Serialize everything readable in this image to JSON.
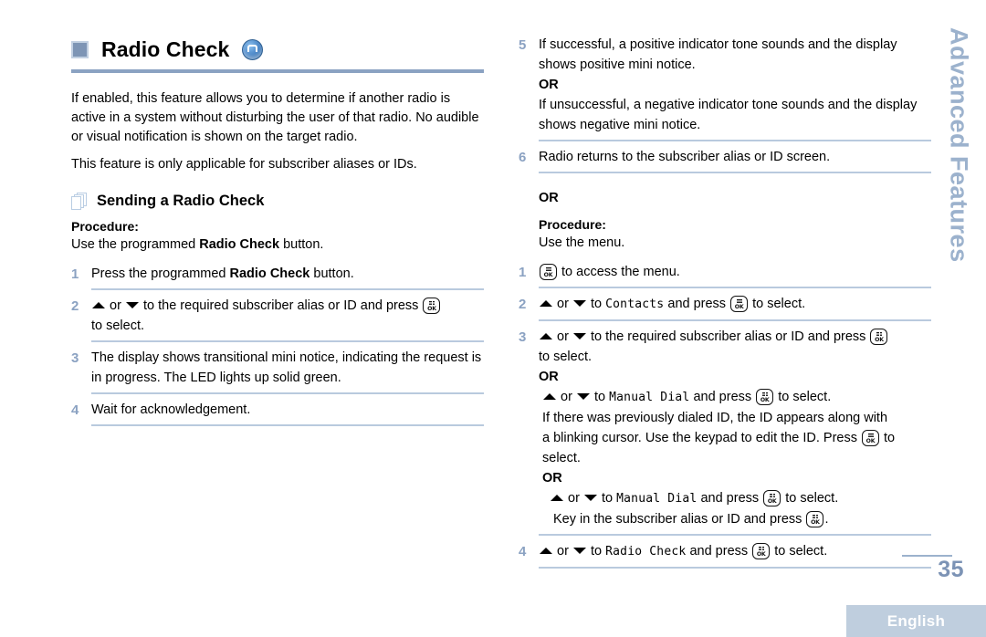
{
  "chapter": {
    "title": "Radio Check",
    "badge_icon": "radio-signal-icon",
    "bullet_icon": "square-bullet-icon"
  },
  "intro": {
    "paragraph_1": "If enabled, this feature allows you to determine if another radio is active in a system without disturbing the user of that radio. No audible or visual notification is shown on the target radio.",
    "paragraph_2": "This feature is only applicable for subscriber aliases or IDs."
  },
  "section": {
    "icon": "stacked-pages-icon",
    "title": "Sending a Radio Check"
  },
  "procedure_button": {
    "label": "Procedure:",
    "lead_prefix": "Use the programmed ",
    "lead_strong": "Radio Check",
    "lead_suffix": " button.",
    "steps": [
      {
        "num": "1",
        "prefix": "Press the programmed ",
        "strong": "Radio Check",
        "suffix": " button."
      },
      {
        "num": "2",
        "line_a_or": "or",
        "line_a_mid": "to the required subscriber alias or ID and press",
        "line_b": "to select."
      },
      {
        "num": "3",
        "text": "The display shows transitional mini notice, indicating the request is in progress. The LED lights up solid green."
      },
      {
        "num": "4",
        "text": "Wait for acknowledgement."
      }
    ]
  },
  "right_column": {
    "step_5": {
      "num": "5",
      "line_1": "If successful, a positive indicator tone sounds and the display shows positive mini notice.",
      "or": "OR",
      "line_2": "If unsuccessful, a negative indicator tone sounds and the display shows negative mini notice."
    },
    "step_6": {
      "num": "6",
      "text": "Radio returns to the subscriber alias or ID screen."
    },
    "or_divider": "OR",
    "procedure_menu": {
      "label": "Procedure:",
      "lead": "Use the menu.",
      "step_1": {
        "num": "1",
        "text": "to access the menu."
      },
      "step_2": {
        "num": "2",
        "or": "or",
        "to": "to",
        "target": "Contacts",
        "and_press": "and press",
        "to_select": "to select."
      },
      "step_3": {
        "num": "3",
        "or": "or",
        "line_a": "to the required subscriber alias or ID and press",
        "line_b": "to select.",
        "or_word": "OR",
        "alt_or": "or",
        "alt_to": "to",
        "alt_target": "Manual Dial",
        "alt_and_press": "and press",
        "alt_to_select": "to select.",
        "note_1": "If there was previously dialed ID, the ID appears along with",
        "note_2a": "a blinking cursor. Use the keypad to edit the ID. Press",
        "note_2b": "to",
        "note_3": "select.",
        "or_word_2": "OR",
        "alt2_or": "or",
        "alt2_to": "to",
        "alt2_target": "Manual Dial",
        "alt2_and_press": "and press",
        "alt2_to_select": "to select.",
        "key_in_prefix": "Key in the subscriber alias or ID and press",
        "key_in_suffix": "."
      },
      "step_4": {
        "num": "4",
        "or": "or",
        "to": "to",
        "target": "Radio Check",
        "and_press": "and press",
        "to_select": "to select."
      }
    }
  },
  "side_tab": {
    "label": "Advanced Features"
  },
  "footer": {
    "page_number": "35",
    "language": "English"
  },
  "colors": {
    "accent_rule": "#8ba2c2",
    "step_number": "#8ba2c2",
    "separator": "#b9cade",
    "side_tab_text": "#9cb2cd",
    "lang_band": "#bfcede",
    "page_number": "#7c93b5"
  }
}
